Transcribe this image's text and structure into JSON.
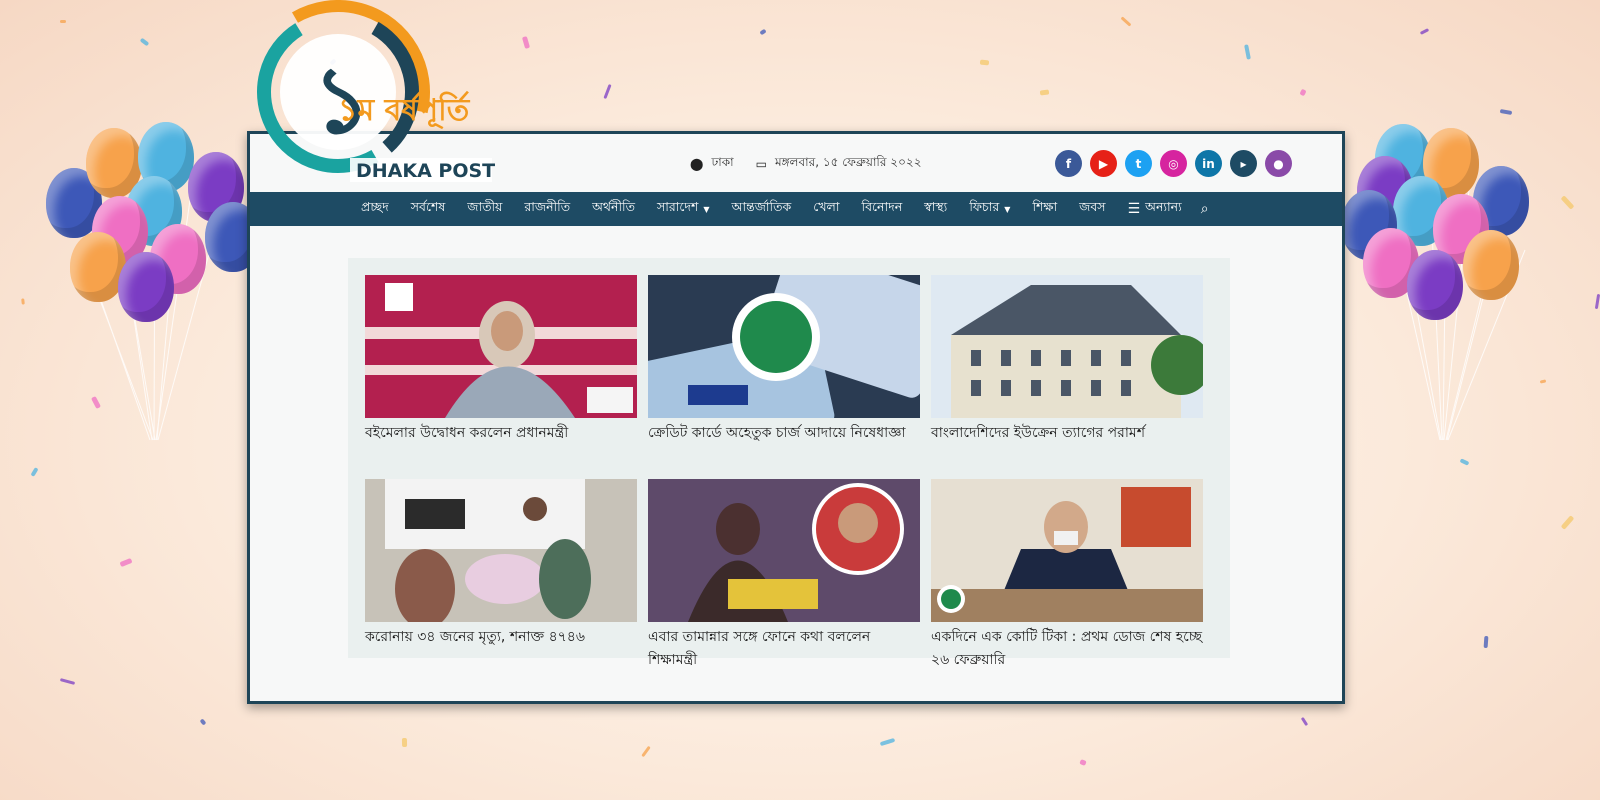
{
  "logo": {
    "anniversary_text": "১ম বর্ষপূর্তি",
    "brand_text": "DHAKA POST"
  },
  "topbar": {
    "location": "ঢাকা",
    "date": "মঙ্গলবার, ১৫ ফেব্রুয়ারি ২০২২",
    "social": [
      {
        "name": "facebook-icon",
        "glyph": "f",
        "color": "#3b5998"
      },
      {
        "name": "youtube-icon",
        "glyph": "▶",
        "color": "#e62117"
      },
      {
        "name": "twitter-icon",
        "glyph": "t",
        "color": "#1da1f2"
      },
      {
        "name": "instagram-icon",
        "glyph": "◎",
        "color": "#d6249f"
      },
      {
        "name": "linkedin-icon",
        "glyph": "in",
        "color": "#0e76a8"
      },
      {
        "name": "google-play-icon",
        "glyph": "▸",
        "color": "#1e4b64"
      },
      {
        "name": "podcast-icon",
        "glyph": "●",
        "color": "#8a4aa8"
      }
    ]
  },
  "nav": {
    "items": [
      {
        "label": "প্রচ্ছদ"
      },
      {
        "label": "সর্বশেষ"
      },
      {
        "label": "জাতীয়"
      },
      {
        "label": "রাজনীতি"
      },
      {
        "label": "অর্থনীতি"
      },
      {
        "label": "সারাদেশ",
        "dropdown": true
      },
      {
        "label": "আন্তর্জাতিক"
      },
      {
        "label": "খেলা"
      },
      {
        "label": "বিনোদন"
      },
      {
        "label": "স্বাস্থ্য"
      },
      {
        "label": "ফিচার",
        "dropdown": true
      },
      {
        "label": "শিক্ষা"
      },
      {
        "label": "জবস"
      }
    ],
    "more_label": "অন্যান্য"
  },
  "news": [
    {
      "title": "বইমেলার উদ্বোধন করলেন প্রধানমন্ত্রী"
    },
    {
      "title": "ক্রেডিট কার্ডে অহেতুক চার্জ আদায়ে নিষেধাজ্ঞা"
    },
    {
      "title": "বাংলাদেশিদের ইউক্রেন ত্যাগের পরামর্শ"
    },
    {
      "title": "করোনায় ৩৪ জনের মৃত্যু, শনাক্ত ৪৭৪৬"
    },
    {
      "title": "এবার তামান্নার সঙ্গে ফোনে কথা বললেন শিক্ষামন্ত্রী"
    },
    {
      "title": "একদিনে এক কোটি টিকা : প্রথম ডোজ শেষ হচ্ছে ২৬ ফেব্রুয়ারি"
    }
  ],
  "thumb_images": [
    "image of the prime minister at the book fair inauguration",
    "image of credit cards with a bank logo",
    "image of an embassy building",
    "image of patients near an ambulance",
    "image of a girl reading with an inset portrait",
    "image of an official in a mask at a desk"
  ],
  "colors": {
    "nav_bg": "#1e4b64",
    "frame": "#1e4558",
    "accent_orange": "#f39a1e",
    "accent_teal": "#1aa3a0"
  }
}
